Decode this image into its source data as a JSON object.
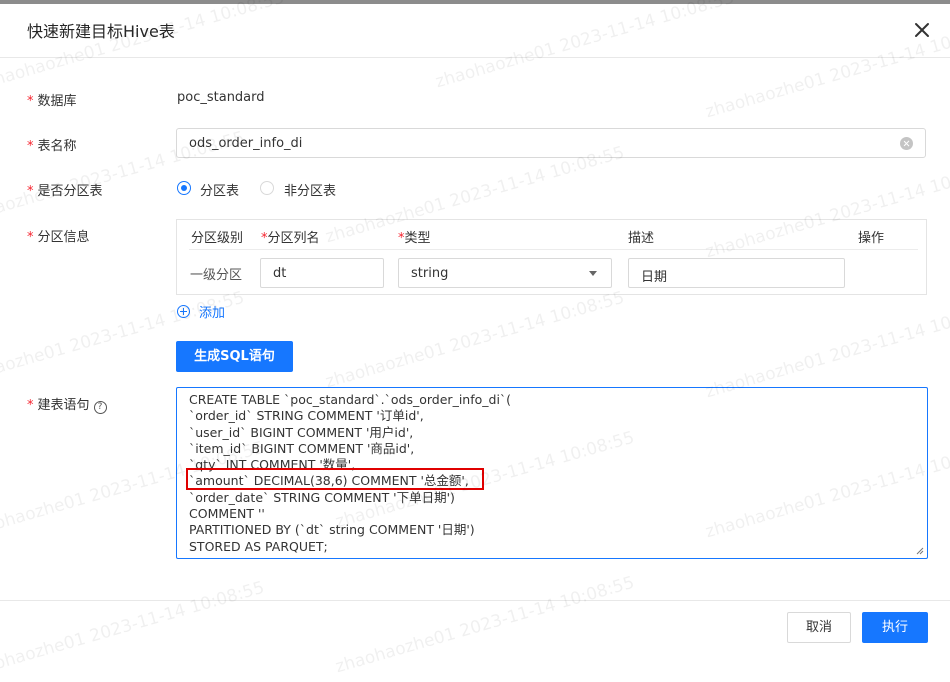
{
  "dialog": {
    "title": "快速新建目标Hive表"
  },
  "form": {
    "database": {
      "label": "数据库",
      "value": "poc_standard"
    },
    "table_name": {
      "label": "表名称",
      "value": "ods_order_info_di"
    },
    "partitioned": {
      "label": "是否分区表",
      "options": [
        "分区表",
        "非分区表"
      ],
      "selected": "分区表"
    },
    "partition_info": {
      "label": "分区信息",
      "headers": {
        "level": "分区级别",
        "column": "分区列名",
        "type": "类型",
        "desc": "描述",
        "action": "操作"
      },
      "rows": [
        {
          "level": "一级分区",
          "column": "dt",
          "type": "string",
          "desc": "日期"
        }
      ],
      "add_label": "添加"
    },
    "generate_button": "生成SQL语句",
    "ddl": {
      "label": "建表语句",
      "help": "?",
      "lines": [
        "CREATE TABLE `poc_standard`.`ods_order_info_di`(",
        "`order_id` STRING COMMENT '订单id',",
        "`user_id` BIGINT COMMENT '用户id',",
        "`item_id` BIGINT COMMENT '商品id',",
        "`qty` INT COMMENT '数量',",
        "`amount` DECIMAL(38,6) COMMENT '总金额',",
        "`order_date` STRING COMMENT '下单日期')",
        "COMMENT ''",
        "PARTITIONED BY (`dt` string COMMENT '日期')",
        "STORED AS PARQUET;"
      ]
    }
  },
  "footer": {
    "cancel": "取消",
    "execute": "执行"
  },
  "watermark": "zhaohaozhe01 2023-11-14 10:08:55",
  "colors": {
    "primary": "#1677ff",
    "required": "#f5222d",
    "highlight": "#e00000"
  }
}
